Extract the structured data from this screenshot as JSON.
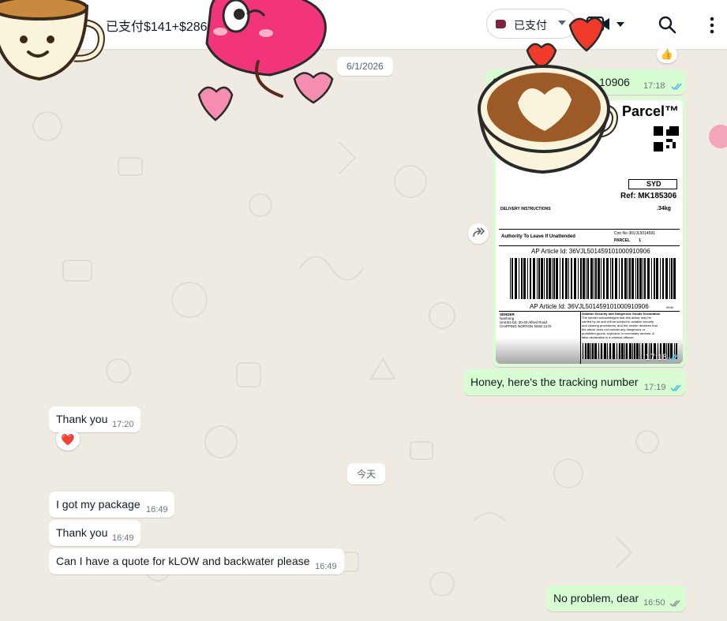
{
  "header": {
    "chat_title": "已支付$141+$286",
    "label_chip": "已支付",
    "icons": [
      "video-call-icon",
      "search-icon",
      "menu-icon"
    ]
  },
  "date_chips": {
    "first": "6/1/2026",
    "today": "今天"
  },
  "messages": {
    "tracking_no": {
      "text": "36VJL501459101000910906",
      "visible_start": "36V",
      "visible_end": "10906",
      "time": "17:18"
    },
    "parcel_image": {
      "time": "17:18",
      "brand": "Parcel™",
      "code": "SYD",
      "ref": "Ref: MK185306",
      "delivery_instructions": "DELIVERY INSTRUCTIONS",
      "weight": ".34kg",
      "authority": "Authority To Leave If Unattended",
      "con_no": "Con No 36VJL5014591",
      "parcel": "PARCEL        1",
      "article_top": "AP Article Id: 36VJL501459101000910906",
      "article_bottom": "AP Article Id: 36VJL501459101000910906",
      "sender_lines": [
        "SENDER",
        "Nanhong",
        "Unit B1-b3, 30-40 Alfred Road",
        "CHIPPING NORTON NSW 2170"
      ],
      "aviation_title": "Aviation Security and Dangerous Goods Declaration",
      "aviation_body": [
        "The sender acknowledges that this article may be",
        "carried by air and will be subject to aviation security",
        "and clearing procedures; and the sender declares that",
        "the article does not contain any dangerous or",
        "prohibited goods, explosive or incendiary devices. A",
        "false declaration is a criminal offence."
      ],
      "small_no": "0530"
    },
    "honey": {
      "text": "Honey, here's the tracking number",
      "time": "17:19"
    },
    "thank_you_1": {
      "text": "Thank you",
      "time": "17:20",
      "reaction": "❤️"
    },
    "got_package": {
      "text": "I got my package",
      "time": "16:49"
    },
    "thank_you_2": {
      "text": "Thank you",
      "time": "16:49"
    },
    "quote": {
      "text": "Can I have a quote for kLOW and backwater please",
      "time": "16:49"
    },
    "no_problem": {
      "text": "No problem, dear",
      "time": "16:50"
    }
  },
  "colors": {
    "outgoing": "#d9fdd3",
    "incoming": "#ffffff",
    "background": "#efeae2",
    "read_tick": "#53bdeb",
    "label_tag": "#7c2243"
  }
}
